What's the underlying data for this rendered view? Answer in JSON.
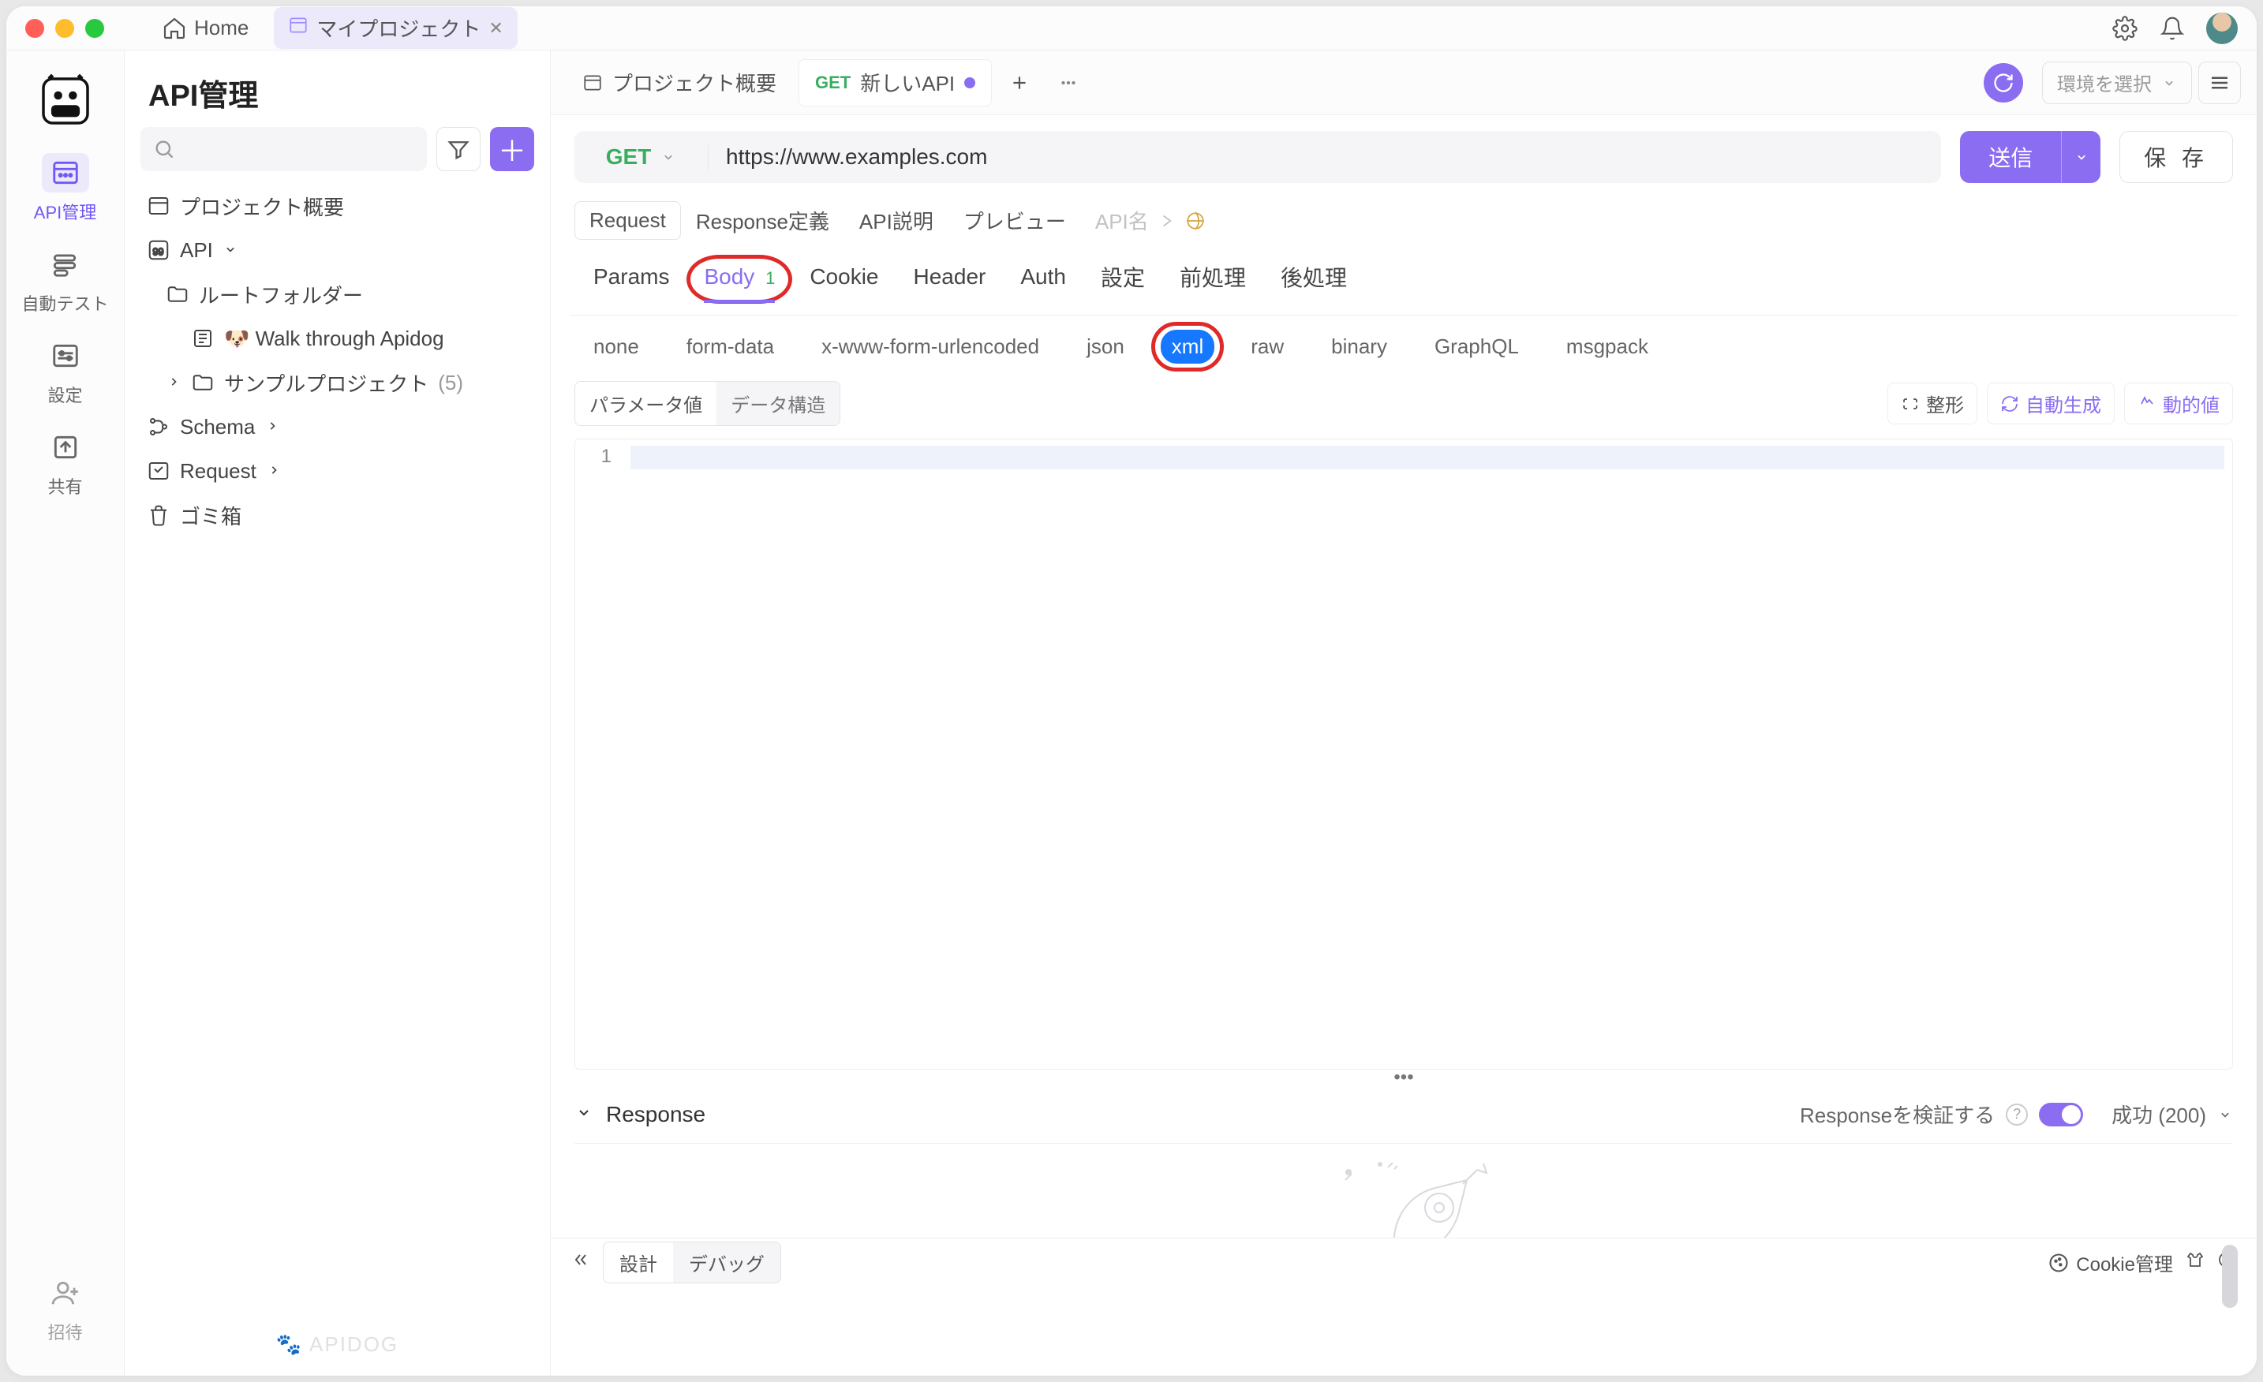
{
  "titlebar": {
    "home": "Home",
    "project_tab": "マイプロジェクト"
  },
  "rail": {
    "api": "API管理",
    "autotest": "自動テスト",
    "settings": "設定",
    "share": "共有",
    "invite": "招待"
  },
  "sidebar": {
    "title": "API管理",
    "overview": "プロジェクト概要",
    "api_root": "API",
    "root_folder": "ルートフォルダー",
    "walkthrough": "🐶 Walk through Apidog",
    "sample_project": "サンプルプロジェクト",
    "sample_count": "(5)",
    "schema": "Schema",
    "request": "Request",
    "trash": "ゴミ箱",
    "footer": "🐾 APIDOG"
  },
  "main_tabs": {
    "overview": "プロジェクト概要",
    "new_api_method": "GET",
    "new_api_label": "新しいAPI",
    "env_placeholder": "環境を選択"
  },
  "url_bar": {
    "method": "GET",
    "url": "https://www.examples.com",
    "send": "送信",
    "save": "保 存"
  },
  "mode_row": {
    "request": "Request",
    "response_def": "Response定義",
    "api_desc": "API説明",
    "preview": "プレビュー",
    "api_name_ph": "API名"
  },
  "sec_tabs": {
    "params": "Params",
    "body": "Body",
    "body_badge": "1",
    "cookie": "Cookie",
    "header": "Header",
    "auth": "Auth",
    "settings": "設定",
    "pre": "前処理",
    "post": "後処理"
  },
  "body_types": {
    "none": "none",
    "formdata": "form-data",
    "xform": "x-www-form-urlencoded",
    "json": "json",
    "xml": "xml",
    "raw": "raw",
    "binary": "binary",
    "graphql": "GraphQL",
    "msgpack": "msgpack"
  },
  "body_opts": {
    "param_val": "パラメータ値",
    "data_struct": "データ構造",
    "format": "整形",
    "autogen": "自動生成",
    "dynamic": "動的値"
  },
  "editor": {
    "line_no": "1"
  },
  "response": {
    "title": "Response",
    "validate": "Responseを検証する",
    "status": "成功 (200)"
  },
  "statusbar": {
    "design": "設計",
    "debug": "デバッグ",
    "cookie": "Cookie管理"
  }
}
